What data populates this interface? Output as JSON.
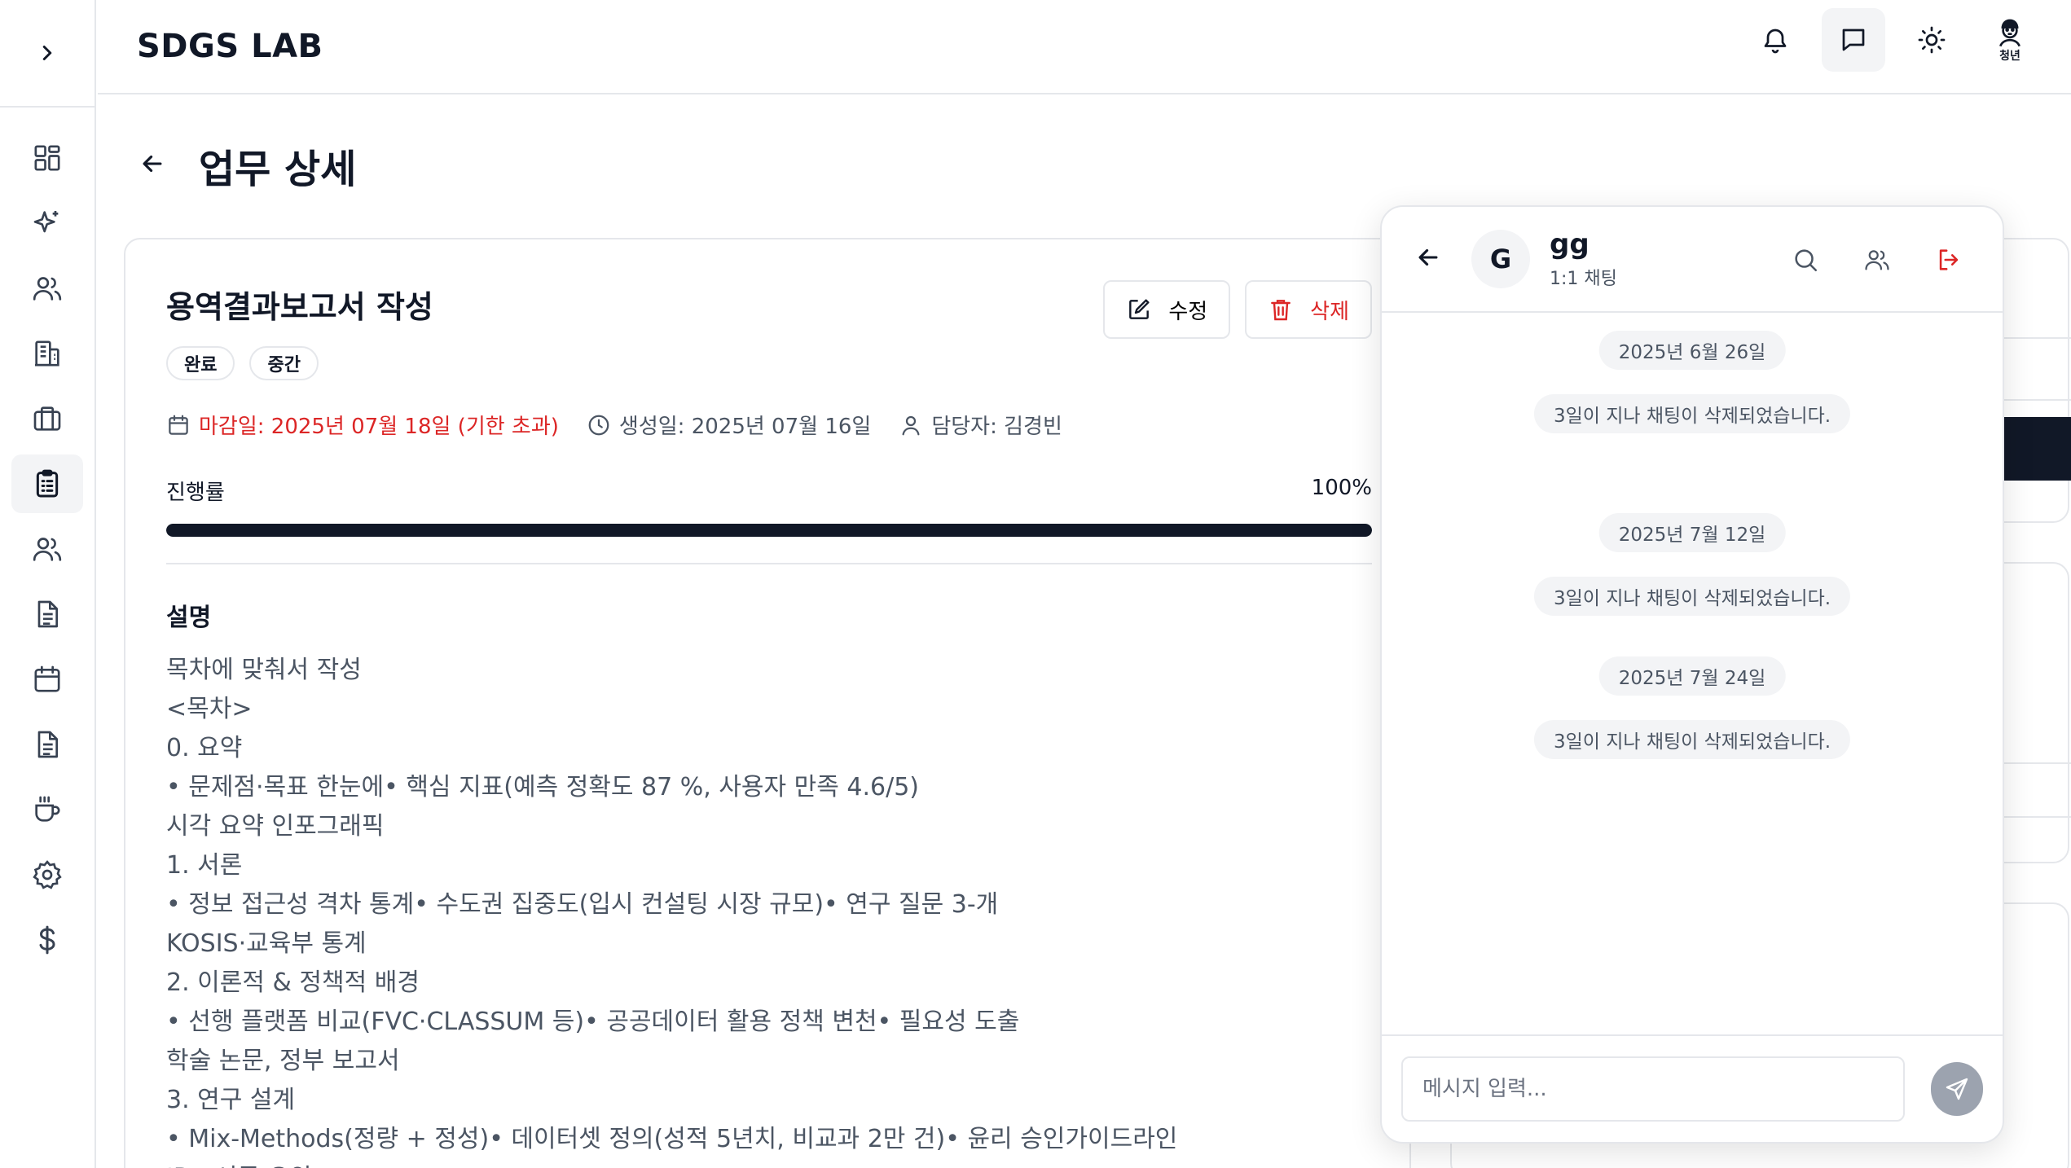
{
  "app": {
    "brand": "SDGS LAB"
  },
  "header": {
    "avatar_label": "청년"
  },
  "page": {
    "title": "업무 상세"
  },
  "task": {
    "title": "용역결과보고서 작성",
    "badges": [
      "완료",
      "중간"
    ],
    "edit_label": "수정",
    "delete_label": "삭제",
    "deadline": "마감일: 2025년 07월 18일 (기한 초과)",
    "created": "생성일: 2025년 07월 16일",
    "assignee": "담당자: 김경빈",
    "progress_label": "진행률",
    "progress_text": "100%",
    "progress_value": 100,
    "description_title": "설명",
    "description_lines": [
      "목차에 맞춰서 작성",
      "<목차>",
      "0. 요약",
      "• 문제점·목표 한눈에• 핵심 지표(예측 정확도 87 %, 사용자 만족 4.6/5)",
      "시각 요약 인포그래픽",
      "1. 서론",
      "• 정보 접근성 격차 통계• 수도권 집중도(입시 컨설팅 시장 규모)• 연구 질문 3-개",
      "KOSIS·교육부 통계",
      "2. 이론적 & 정책적 배경",
      "• 선행 플랫폼 비교(FVC·CLASSUM 등)• 공공데이터 활용 정책 변천• 필요성 도출",
      "학술 논문, 정부 보고서",
      "3. 연구 설계",
      "• Mix-Methods(정량 + 정성)• 데이터셋 정의(성적 5년치, 비교과 2만 건)• 윤리 승인가이드라인",
      "IRB 서류 요약"
    ]
  },
  "chat": {
    "avatar_initial": "G",
    "name": "gg",
    "type": "1:1 채팅",
    "messages": [
      {
        "date": "2025년 6월 26일",
        "notice": "3일이 지나 채팅이 삭제되었습니다."
      },
      {
        "date": "2025년 7월 12일",
        "notice": "3일이 지나 채팅이 삭제되었습니다."
      },
      {
        "date": "2025년 7월 24일",
        "notice": "3일이 지나 채팅이 삭제되었습니다."
      }
    ],
    "input_placeholder": "메시지 입력..."
  },
  "icons": {
    "sidebar": [
      "dashboard-icon",
      "sparkles-icon",
      "users-icon",
      "building-icon",
      "briefcase-icon",
      "clipboard-icon",
      "team-icon",
      "document-icon",
      "calendar-icon",
      "report-icon",
      "coffee-icon",
      "gear-icon",
      "dollar-icon"
    ],
    "header": [
      "bell-icon",
      "message-icon",
      "sun-icon"
    ]
  },
  "colors": {
    "danger": "#dc2626",
    "progress": "#111827",
    "active_bg": "#f3f4f6"
  }
}
